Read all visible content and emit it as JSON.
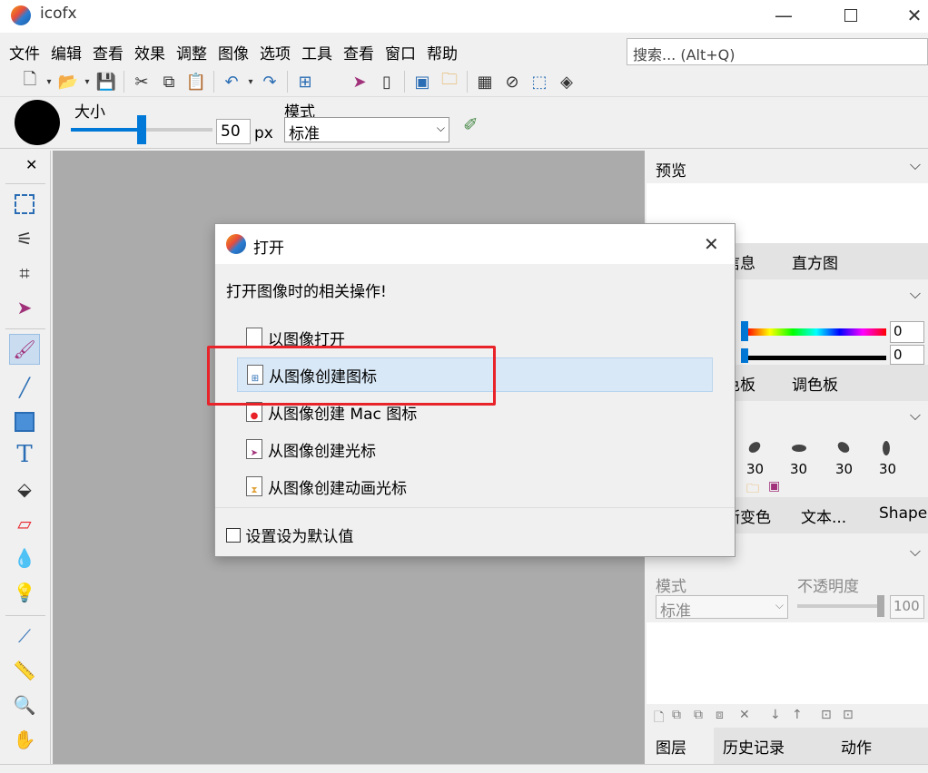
{
  "app": {
    "title": "icofx"
  },
  "menu": [
    "文件",
    "编辑",
    "查看",
    "效果",
    "调整",
    "图像",
    "选项",
    "工具",
    "查看",
    "窗口",
    "帮助"
  ],
  "search": {
    "placeholder": "搜索... (Alt+Q)"
  },
  "options_bar": {
    "size_label": "大小",
    "size_value": "50",
    "size_unit": "px",
    "size_fraction": 0.5,
    "mode_label": "模式",
    "mode_value": "标准"
  },
  "right_panel": {
    "preview_title": "预览",
    "tabs1": [
      "信息",
      "直方图"
    ],
    "color_values": [
      "0",
      "0"
    ],
    "tabs2": [
      "色板",
      "调色板"
    ],
    "brush_sizes": [
      "30",
      "30",
      "30",
      "30"
    ],
    "tabs3": [
      "渐变色",
      "文本...",
      "Shapes"
    ],
    "layers_title": "图层",
    "layers_mode_label": "模式",
    "layers_mode_value": "标准",
    "opacity_label": "不透明度",
    "opacity_value": "100",
    "bottom_tabs": [
      "图层",
      "历史记录",
      "动作"
    ]
  },
  "dialog": {
    "title": "打开",
    "heading": "打开图像时的相关操作!",
    "options": [
      {
        "label": "以图像打开",
        "icon": "file-icon"
      },
      {
        "label": "从图像创建图标",
        "icon": "icon-file-icon",
        "selected": true
      },
      {
        "label": "从图像创建 Mac 图标",
        "icon": "mac-icon-file-icon"
      },
      {
        "label": "从图像创建光标",
        "icon": "cursor-file-icon"
      },
      {
        "label": "从图像创建动画光标",
        "icon": "animated-cursor-file-icon"
      }
    ],
    "checkbox_label": "设置设为默认值"
  },
  "colors": {
    "accent": "#0078d7",
    "highlight": "#e8232a",
    "canvas": "#ababab"
  }
}
